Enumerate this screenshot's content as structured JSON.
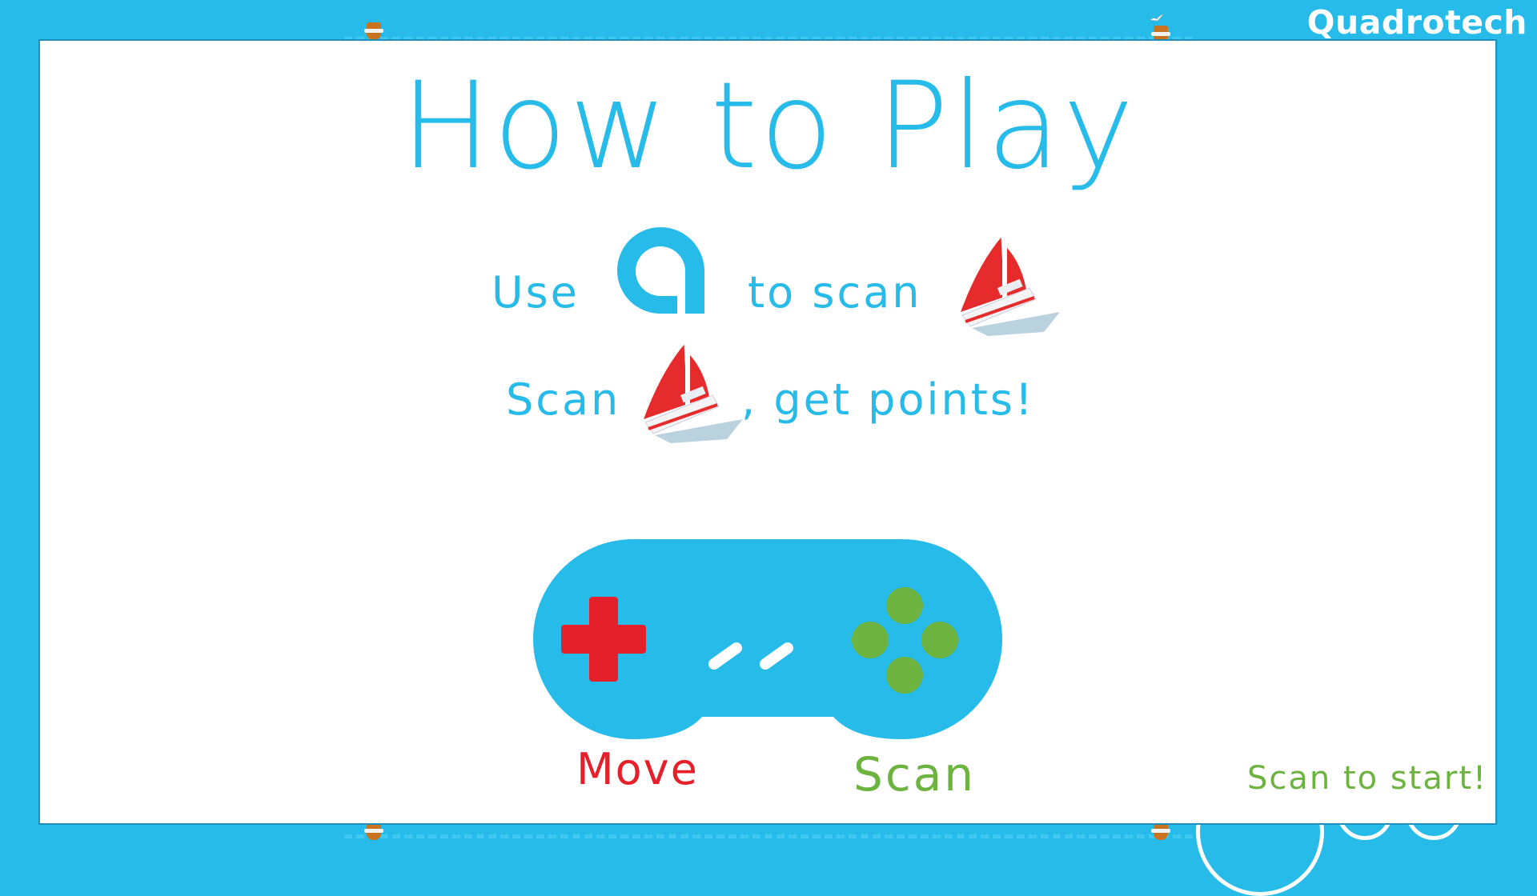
{
  "brand": {
    "name": "Quadrotech"
  },
  "colors": {
    "background": "#27bbe9",
    "primary_text": "#27bbe9",
    "move": "#e5202a",
    "scan": "#6db33f",
    "panel": "#ffffff"
  },
  "howto": {
    "title": "How to Play",
    "line1": {
      "prefix": "Use",
      "middle": "to scan"
    },
    "line2": {
      "prefix": "Scan",
      "suffix": ", get points!"
    }
  },
  "controls": {
    "move_label": "Move",
    "scan_label": "Scan"
  },
  "prompt": {
    "start": "Scan to start!"
  },
  "icons": [
    "q-logo-icon",
    "sailboat-icon",
    "dpad-icon",
    "face-buttons-icon",
    "seagull-icon",
    "buoy-icon"
  ]
}
